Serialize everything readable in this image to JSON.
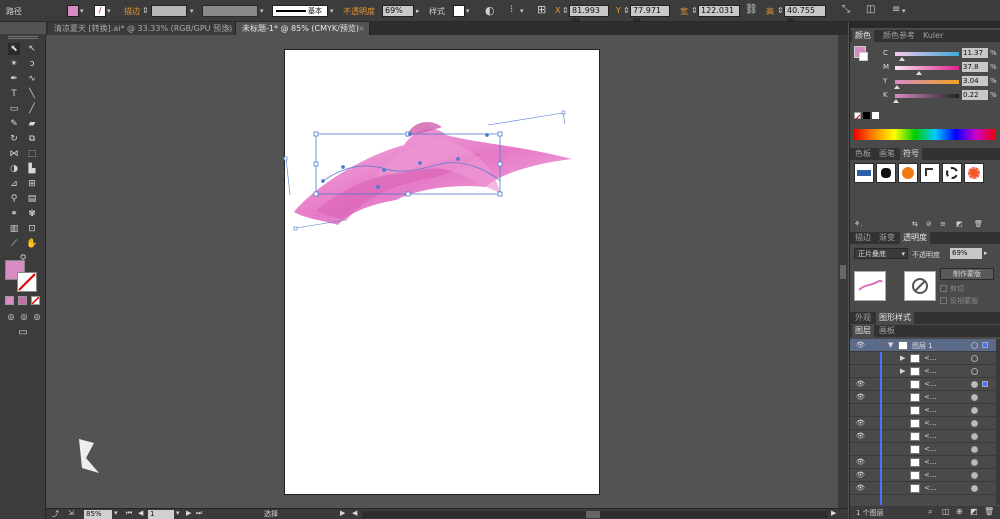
{
  "control_bar": {
    "object_type": "路径",
    "stroke_label": "描边",
    "stroke_profile": "基本",
    "opacity_label": "不透明度",
    "opacity_value": "69%",
    "style_label": "样式",
    "x_label": "X",
    "x_value": "81.993 m",
    "y_label": "Y",
    "y_value": "77.971 m",
    "w_label": "宽",
    "w_value": "122.031",
    "h_label": "高",
    "h_value": "40.755 m"
  },
  "tabs": [
    {
      "label": "清凉夏天 [转换].ai* @ 33.33% (RGB/GPU 预览)",
      "close": "×"
    },
    {
      "label": "未标题-1* @ 85% (CMYK/预览)",
      "close": "×"
    }
  ],
  "status_bar": {
    "zoom": "85%",
    "artboard_num": "1",
    "tool_name": "选择"
  },
  "color_panel": {
    "tabs": [
      "颜色",
      "颜色参考",
      "Kuler"
    ],
    "sliders": [
      {
        "label": "C",
        "value": "11.37",
        "unit": "%",
        "knob": 0.11
      },
      {
        "label": "M",
        "value": "37.8",
        "unit": "%",
        "knob": 0.38
      },
      {
        "label": "Y",
        "value": "3.04",
        "unit": "%",
        "knob": 0.03
      },
      {
        "label": "K",
        "value": "0.22",
        "unit": "%",
        "knob": 0.01
      }
    ],
    "fill_color": "#d88cc4"
  },
  "symbols_panel": {
    "tabs": [
      "色板",
      "画笔",
      "符号"
    ]
  },
  "transparency_panel": {
    "tabs": [
      "描边",
      "渐变",
      "透明度"
    ],
    "blend_mode": "正片叠底",
    "opacity_label": "不透明度",
    "opacity_value": "69%",
    "make_mask": "制作蒙版",
    "clip": "剪切",
    "invert_mask": "反相蒙版"
  },
  "appearance_panel": {
    "tabs": [
      "外观",
      "图形样式"
    ]
  },
  "layers_panel": {
    "tabs": [
      "图层",
      "画板"
    ],
    "layer_name": "图层 1",
    "sublayer_label": "<...",
    "footer": "1 个图层"
  }
}
